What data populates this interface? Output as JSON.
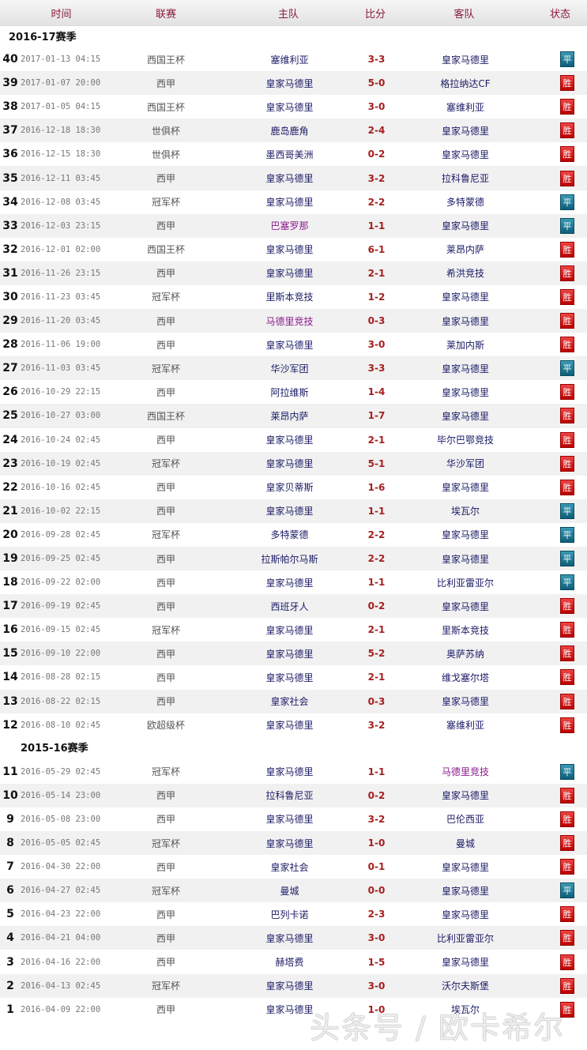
{
  "header": {
    "time": "时间",
    "league": "联赛",
    "home": "主队",
    "score": "比分",
    "away": "客队",
    "status": "状态"
  },
  "colors": {
    "win": "#cc1111",
    "draw": "#157a96",
    "header_text": "#8b1a3a"
  },
  "seasons": [
    {
      "label": "2016-17赛季",
      "rows": [
        [
          "40",
          "2017-01-13 04:15",
          "西国王杯",
          "塞维利亚",
          "3-3",
          "皇家马德里",
          "平"
        ],
        [
          "39",
          "2017-01-07 20:00",
          "西甲",
          "皇家马德里",
          "5-0",
          "格拉纳达CF",
          "胜"
        ],
        [
          "38",
          "2017-01-05 04:15",
          "西国王杯",
          "皇家马德里",
          "3-0",
          "塞维利亚",
          "胜"
        ],
        [
          "37",
          "2016-12-18 18:30",
          "世俱杯",
          "鹿岛鹿角",
          "2-4",
          "皇家马德里",
          "胜"
        ],
        [
          "36",
          "2016-12-15 18:30",
          "世俱杯",
          "墨西哥美洲",
          "0-2",
          "皇家马德里",
          "胜"
        ],
        [
          "35",
          "2016-12-11 03:45",
          "西甲",
          "皇家马德里",
          "3-2",
          "拉科鲁尼亚",
          "胜"
        ],
        [
          "34",
          "2016-12-08 03:45",
          "冠军杯",
          "皇家马德里",
          "2-2",
          "多特蒙德",
          "平"
        ],
        [
          "33",
          "2016-12-03 23:15",
          "西甲",
          "巴塞罗那",
          "1-1",
          "皇家马德里",
          "平"
        ],
        [
          "32",
          "2016-12-01 02:00",
          "西国王杯",
          "皇家马德里",
          "6-1",
          "莱昂内萨",
          "胜"
        ],
        [
          "31",
          "2016-11-26 23:15",
          "西甲",
          "皇家马德里",
          "2-1",
          "希洪竞技",
          "胜"
        ],
        [
          "30",
          "2016-11-23 03:45",
          "冠军杯",
          "里斯本竞技",
          "1-2",
          "皇家马德里",
          "胜"
        ],
        [
          "29",
          "2016-11-20 03:45",
          "西甲",
          "马德里竞技",
          "0-3",
          "皇家马德里",
          "胜"
        ],
        [
          "28",
          "2016-11-06 19:00",
          "西甲",
          "皇家马德里",
          "3-0",
          "莱加内斯",
          "胜"
        ],
        [
          "27",
          "2016-11-03 03:45",
          "冠军杯",
          "华沙军团",
          "3-3",
          "皇家马德里",
          "平"
        ],
        [
          "26",
          "2016-10-29 22:15",
          "西甲",
          "阿拉维斯",
          "1-4",
          "皇家马德里",
          "胜"
        ],
        [
          "25",
          "2016-10-27 03:00",
          "西国王杯",
          "莱昂内萨",
          "1-7",
          "皇家马德里",
          "胜"
        ],
        [
          "24",
          "2016-10-24 02:45",
          "西甲",
          "皇家马德里",
          "2-1",
          "毕尔巴鄂竞技",
          "胜"
        ],
        [
          "23",
          "2016-10-19 02:45",
          "冠军杯",
          "皇家马德里",
          "5-1",
          "华沙军团",
          "胜"
        ],
        [
          "22",
          "2016-10-16 02:45",
          "西甲",
          "皇家贝蒂斯",
          "1-6",
          "皇家马德里",
          "胜"
        ],
        [
          "21",
          "2016-10-02 22:15",
          "西甲",
          "皇家马德里",
          "1-1",
          "埃瓦尔",
          "平"
        ],
        [
          "20",
          "2016-09-28 02:45",
          "冠军杯",
          "多特蒙德",
          "2-2",
          "皇家马德里",
          "平"
        ],
        [
          "19",
          "2016-09-25 02:45",
          "西甲",
          "拉斯帕尔马斯",
          "2-2",
          "皇家马德里",
          "平"
        ],
        [
          "18",
          "2016-09-22 02:00",
          "西甲",
          "皇家马德里",
          "1-1",
          "比利亚雷亚尔",
          "平"
        ],
        [
          "17",
          "2016-09-19 02:45",
          "西甲",
          "西班牙人",
          "0-2",
          "皇家马德里",
          "胜"
        ],
        [
          "16",
          "2016-09-15 02:45",
          "冠军杯",
          "皇家马德里",
          "2-1",
          "里斯本竞技",
          "胜"
        ],
        [
          "15",
          "2016-09-10 22:00",
          "西甲",
          "皇家马德里",
          "5-2",
          "奥萨苏纳",
          "胜"
        ],
        [
          "14",
          "2016-08-28 02:15",
          "西甲",
          "皇家马德里",
          "2-1",
          "维戈塞尔塔",
          "胜"
        ],
        [
          "13",
          "2016-08-22 02:15",
          "西甲",
          "皇家社会",
          "0-3",
          "皇家马德里",
          "胜"
        ],
        [
          "12",
          "2016-08-10 02:45",
          "欧超级杯",
          "皇家马德里",
          "3-2",
          "塞维利亚",
          "胜"
        ]
      ]
    },
    {
      "label": "2015-16赛季",
      "rows": [
        [
          "11",
          "2016-05-29 02:45",
          "冠军杯",
          "皇家马德里",
          "1-1",
          "马德里竞技",
          "平"
        ],
        [
          "10",
          "2016-05-14 23:00",
          "西甲",
          "拉科鲁尼亚",
          "0-2",
          "皇家马德里",
          "胜"
        ],
        [
          "9",
          "2016-05-08 23:00",
          "西甲",
          "皇家马德里",
          "3-2",
          "巴伦西亚",
          "胜"
        ],
        [
          "8",
          "2016-05-05 02:45",
          "冠军杯",
          "皇家马德里",
          "1-0",
          "曼城",
          "胜"
        ],
        [
          "7",
          "2016-04-30 22:00",
          "西甲",
          "皇家社会",
          "0-1",
          "皇家马德里",
          "胜"
        ],
        [
          "6",
          "2016-04-27 02:45",
          "冠军杯",
          "曼城",
          "0-0",
          "皇家马德里",
          "平"
        ],
        [
          "5",
          "2016-04-23 22:00",
          "西甲",
          "巴列卡诺",
          "2-3",
          "皇家马德里",
          "胜"
        ],
        [
          "4",
          "2016-04-21 04:00",
          "西甲",
          "皇家马德里",
          "3-0",
          "比利亚雷亚尔",
          "胜"
        ],
        [
          "3",
          "2016-04-16 22:00",
          "西甲",
          "赫塔费",
          "1-5",
          "皇家马德里",
          "胜"
        ],
        [
          "2",
          "2016-04-13 02:45",
          "冠军杯",
          "皇家马德里",
          "3-0",
          "沃尔夫斯堡",
          "胜"
        ],
        [
          "1",
          "2016-04-09 22:00",
          "西甲",
          "皇家马德里",
          "1-0",
          "埃瓦尔",
          "胜"
        ]
      ]
    }
  ],
  "highlight_teams": [
    "巴塞罗那",
    "马德里竞技"
  ],
  "watermark": "头条号 / 欧卡希尔"
}
